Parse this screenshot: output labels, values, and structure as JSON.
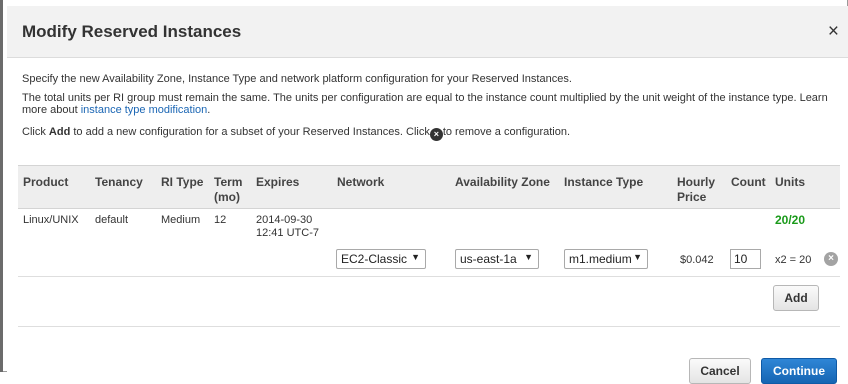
{
  "dialog": {
    "title": "Modify Reserved Instances",
    "close_glyph": "×"
  },
  "description": {
    "line1": "Specify the new Availability Zone, Instance Type and network platform configuration for your Reserved Instances.",
    "line2": "The total units per RI group must remain the same. The units per configuration are equal to the instance count multiplied by the unit weight of the instance type. Learn more about",
    "link": "instance type modification",
    "line2_end": ".",
    "line3_a": "Click",
    "line3_b": "Add",
    "line3_c": "to add a new configuration for a subset of your Reserved Instances. Click",
    "line3_d": "to remove a configuration."
  },
  "table": {
    "headers": {
      "product": "Product",
      "tenancy": "Tenancy",
      "ri_type": "RI Type",
      "term_1": "Term",
      "term_2": "(mo)",
      "expires": "Expires",
      "network": "Network",
      "az": "Availability Zone",
      "instance_type": "Instance Type",
      "hourly_1": "Hourly",
      "hourly_2": "Price",
      "count": "Count",
      "units": "Units"
    },
    "row": {
      "product": "Linux/UNIX",
      "tenancy": "default",
      "ri_type": "Medium",
      "term": "12",
      "expires_1": "2014-09-30",
      "expires_2": "12:41 UTC-7",
      "units": "20/20"
    },
    "config": {
      "network": "EC2-Classic",
      "az": "us-east-1a",
      "instance_type": "m1.medium",
      "hourly_price": "$0.042",
      "count": "10",
      "units": "x2 = 20"
    }
  },
  "buttons": {
    "add": "Add",
    "cancel": "Cancel",
    "continue": "Continue"
  },
  "icons": {
    "select_arrow": "▼",
    "remove": "×"
  },
  "colors": {
    "units_ok": "#1a9a1a",
    "primary": "#1d72c4",
    "link": "#1b66b4"
  }
}
